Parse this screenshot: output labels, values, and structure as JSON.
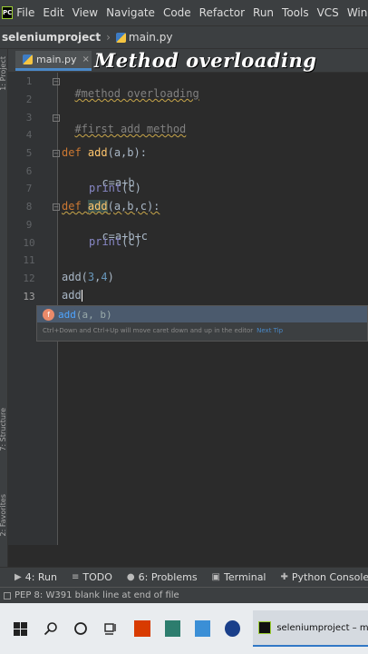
{
  "menu": [
    "File",
    "Edit",
    "View",
    "Navigate",
    "Code",
    "Refactor",
    "Run",
    "Tools",
    "VCS",
    "Window"
  ],
  "breadcrumb": {
    "project": "seleniumproject",
    "file": "main.py"
  },
  "tab": {
    "label": "main.py",
    "close": "×"
  },
  "overlay_title": "Method overloading",
  "left_stripe": {
    "project": "1: Project",
    "structure": "7: Structure",
    "favorites": "2: Favorites"
  },
  "editor": {
    "line_numbers": [
      "1",
      "2",
      "3",
      "4",
      "5",
      "6",
      "7",
      "8",
      "9",
      "10",
      "11",
      "12",
      "13"
    ],
    "lines": {
      "l1": "#method overloading",
      "l3": "#first add method",
      "l5_def": "def ",
      "l5_name": "add",
      "l5_params": "(a,b):",
      "l6": "c=a+b",
      "l7_print": "print",
      "l7_args": "(c)",
      "l8_def": "def ",
      "l8_name": "add",
      "l8_params": "(a,b,c):",
      "l9": "c=a+b+c",
      "l10_print": "print",
      "l10_args": "(c)",
      "l12_call": "add(",
      "l12_arg1": "3",
      "l12_comma": ",",
      "l12_arg2": "4",
      "l12_close": ")",
      "l13": "add"
    }
  },
  "completion": {
    "badge": "f",
    "name": "add",
    "args": "(a, b)",
    "hint": "Ctrl+Down and Ctrl+Up will move caret down and up in the editor",
    "next_tip": "Next Tip"
  },
  "tool_windows": [
    {
      "icon": "▶",
      "label": "4: Run"
    },
    {
      "icon": "≡",
      "label": "TODO"
    },
    {
      "icon": "●",
      "label": "6: Problems"
    },
    {
      "icon": "▣",
      "label": "Terminal"
    },
    {
      "icon": "✚",
      "label": "Python Console"
    }
  ],
  "status": {
    "message": "PEP 8: W391 blank line at end of file"
  },
  "taskbar": {
    "running_app": "seleniumproject – ma..."
  },
  "colors": {
    "keyword": "#cc7832",
    "function": "#ffc66d",
    "comment": "#808080",
    "number": "#6897bb",
    "builtin": "#8888c6",
    "accent": "#4a88c7"
  }
}
